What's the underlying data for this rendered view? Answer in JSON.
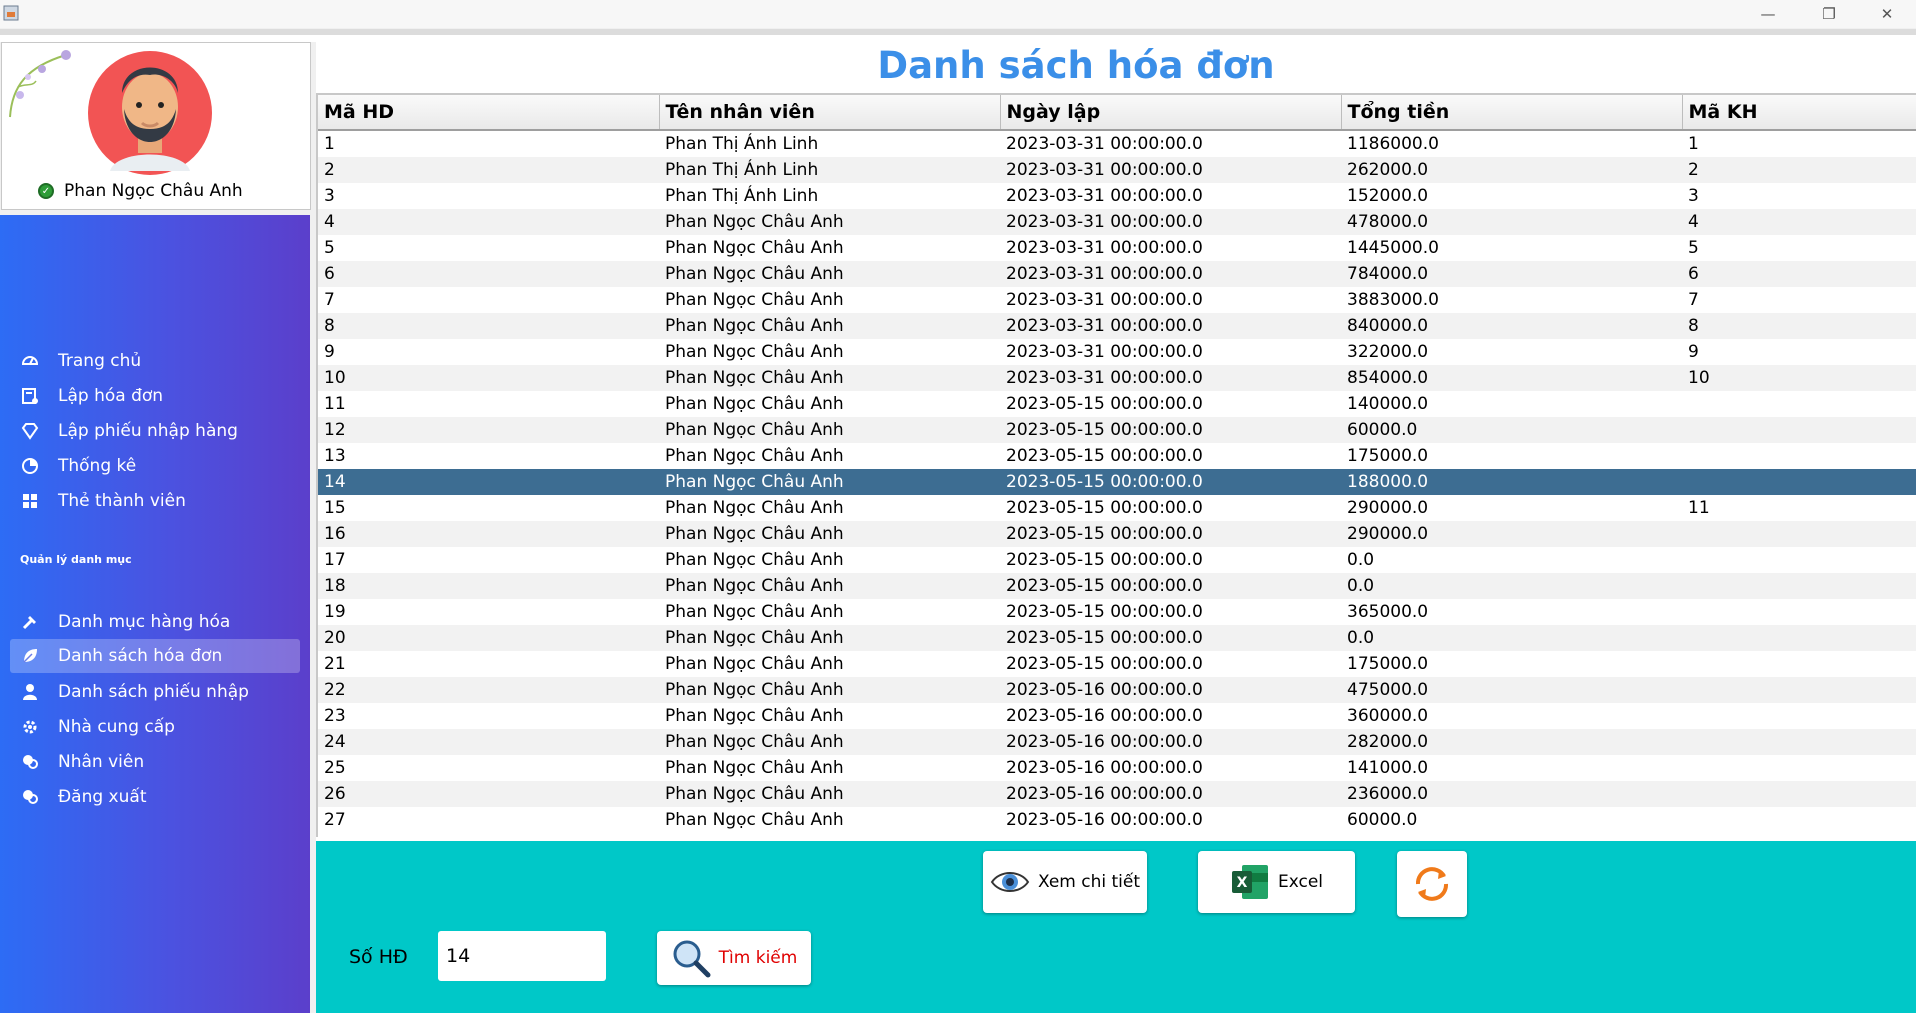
{
  "window": {
    "minimize": "—",
    "restore": "❐",
    "close": "✕"
  },
  "user": {
    "name": "Phan Ngọc Châu Anh"
  },
  "nav": {
    "items": [
      {
        "label": "Trang chủ",
        "icon": "dashboard-icon"
      },
      {
        "label": "Lập hóa đơn",
        "icon": "invoice-icon"
      },
      {
        "label": "Lập phiếu nhập hàng",
        "icon": "diamond-icon"
      },
      {
        "label": "Thống kê",
        "icon": "pie-chart-icon"
      },
      {
        "label": "Thẻ thành viên",
        "icon": "grid-icon"
      }
    ],
    "section_label": "Quản lý danh mục",
    "manage_items": [
      {
        "label": "Danh mục hàng hóa",
        "icon": "hammer-icon"
      },
      {
        "label": "Danh sách hóa đơn",
        "icon": "leaf-icon",
        "active": true
      },
      {
        "label": "Danh sách phiếu nhập",
        "icon": "person-icon"
      },
      {
        "label": "Nhà cung cấp",
        "icon": "gear-icon"
      },
      {
        "label": "Nhân viên",
        "icon": "chat-icon"
      },
      {
        "label": "Đăng xuất",
        "icon": "logout-icon"
      }
    ]
  },
  "page": {
    "title": "Danh sách hóa đơn"
  },
  "table": {
    "columns": [
      "Mã HD",
      "Tên nhân viên",
      "Ngày lập",
      "Tổng tiền",
      "Mã KH"
    ],
    "selected_row": 13,
    "rows": [
      [
        "1",
        "Phan Thị Ánh Linh",
        "2023-03-31 00:00:00.0",
        "1186000.0",
        "1"
      ],
      [
        "2",
        "Phan Thị Ánh Linh",
        "2023-03-31 00:00:00.0",
        "262000.0",
        "2"
      ],
      [
        "3",
        "Phan Thị Ánh Linh",
        "2023-03-31 00:00:00.0",
        "152000.0",
        "3"
      ],
      [
        "4",
        "Phan Ngọc Châu Anh",
        "2023-03-31 00:00:00.0",
        "478000.0",
        "4"
      ],
      [
        "5",
        "Phan Ngọc Châu Anh",
        "2023-03-31 00:00:00.0",
        "1445000.0",
        "5"
      ],
      [
        "6",
        "Phan Ngọc Châu Anh",
        "2023-03-31 00:00:00.0",
        "784000.0",
        "6"
      ],
      [
        "7",
        "Phan Ngọc Châu Anh",
        "2023-03-31 00:00:00.0",
        "3883000.0",
        "7"
      ],
      [
        "8",
        "Phan Ngọc Châu Anh",
        "2023-03-31 00:00:00.0",
        "840000.0",
        "8"
      ],
      [
        "9",
        "Phan Ngọc Châu Anh",
        "2023-03-31 00:00:00.0",
        "322000.0",
        "9"
      ],
      [
        "10",
        "Phan Ngọc Châu Anh",
        "2023-03-31 00:00:00.0",
        "854000.0",
        "10"
      ],
      [
        "11",
        "Phan Ngọc Châu Anh",
        "2023-05-15 00:00:00.0",
        "140000.0",
        ""
      ],
      [
        "12",
        "Phan Ngọc Châu Anh",
        "2023-05-15 00:00:00.0",
        "60000.0",
        ""
      ],
      [
        "13",
        "Phan Ngọc Châu Anh",
        "2023-05-15 00:00:00.0",
        "175000.0",
        ""
      ],
      [
        "14",
        "Phan Ngọc Châu Anh",
        "2023-05-15 00:00:00.0",
        "188000.0",
        ""
      ],
      [
        "15",
        "Phan Ngọc Châu Anh",
        "2023-05-15 00:00:00.0",
        "290000.0",
        "11"
      ],
      [
        "16",
        "Phan Ngọc Châu Anh",
        "2023-05-15 00:00:00.0",
        "290000.0",
        ""
      ],
      [
        "17",
        "Phan Ngọc Châu Anh",
        "2023-05-15 00:00:00.0",
        "0.0",
        ""
      ],
      [
        "18",
        "Phan Ngọc Châu Anh",
        "2023-05-15 00:00:00.0",
        "0.0",
        ""
      ],
      [
        "19",
        "Phan Ngọc Châu Anh",
        "2023-05-15 00:00:00.0",
        "365000.0",
        ""
      ],
      [
        "20",
        "Phan Ngọc Châu Anh",
        "2023-05-15 00:00:00.0",
        "0.0",
        ""
      ],
      [
        "21",
        "Phan Ngọc Châu Anh",
        "2023-05-15 00:00:00.0",
        "175000.0",
        ""
      ],
      [
        "22",
        "Phan Ngọc Châu Anh",
        "2023-05-16 00:00:00.0",
        "475000.0",
        ""
      ],
      [
        "23",
        "Phan Ngọc Châu Anh",
        "2023-05-16 00:00:00.0",
        "360000.0",
        ""
      ],
      [
        "24",
        "Phan Ngọc Châu Anh",
        "2023-05-16 00:00:00.0",
        "282000.0",
        ""
      ],
      [
        "25",
        "Phan Ngọc Châu Anh",
        "2023-05-16 00:00:00.0",
        "141000.0",
        ""
      ],
      [
        "26",
        "Phan Ngọc Châu Anh",
        "2023-05-16 00:00:00.0",
        "236000.0",
        ""
      ],
      [
        "27",
        "Phan Ngọc Châu Anh",
        "2023-05-16 00:00:00.0",
        "60000.0",
        ""
      ]
    ]
  },
  "actions": {
    "view_detail": "Xem chi tiết",
    "excel": "Excel",
    "search": "Tìm kiếm"
  },
  "search": {
    "label": "Số HĐ",
    "value": "14"
  },
  "colors": {
    "title": "#3b8fe8",
    "selected_row": "#3d6d92",
    "bottom_panel": "#00c8c8",
    "search_text": "#e00000"
  }
}
